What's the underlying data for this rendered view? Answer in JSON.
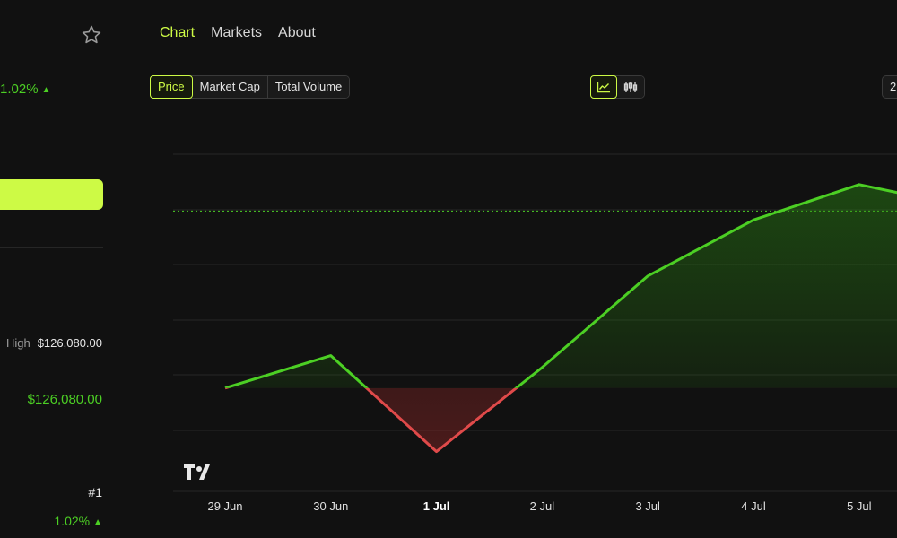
{
  "left_panel": {
    "change_top": "1.02%",
    "up_arrow": "▲",
    "high_label": "High",
    "high_value": "$126,080.00",
    "price_value": "$126,080.00",
    "rank": "#1",
    "change_bottom": "1.02%"
  },
  "tabs": [
    {
      "label": "Chart",
      "active": true
    },
    {
      "label": "Markets",
      "active": false
    },
    {
      "label": "About",
      "active": false
    }
  ],
  "metric_options": [
    {
      "label": "Price",
      "active": true
    },
    {
      "label": "Market Cap",
      "active": false
    },
    {
      "label": "Total Volume",
      "active": false
    }
  ],
  "chart_style_icons": [
    "line-chart-icon",
    "candlestick-icon"
  ],
  "range_button": "2",
  "colors": {
    "accent": "#cdfa45",
    "up": "#4ccf24",
    "down": "#e04a4a",
    "background": "#111111"
  },
  "chart_data": {
    "type": "line",
    "x": [
      "29 Jun",
      "30 Jun",
      "1 Jul",
      "2 Jul",
      "3 Jul",
      "4 Jul",
      "5 Jul"
    ],
    "highlight_tick": "1 Jul",
    "points": [
      {
        "x": "29 Jun",
        "y": 0.0
      },
      {
        "x": "30 Jun",
        "y": 1.1
      },
      {
        "x": "1 Jul",
        "y": -2.15
      },
      {
        "x": "2 Jul",
        "y": 0.7
      },
      {
        "x": "3 Jul",
        "y": 3.8
      },
      {
        "x": "4 Jul",
        "y": 5.7
      },
      {
        "x": "5 Jul",
        "y": 6.9
      },
      {
        "x": "5.4 Jul",
        "y": 6.6
      }
    ],
    "baseline": 0.0,
    "reference_line": 6.0,
    "ylim": [
      -3.5,
      8.9
    ],
    "grid": true,
    "legend": "none"
  }
}
